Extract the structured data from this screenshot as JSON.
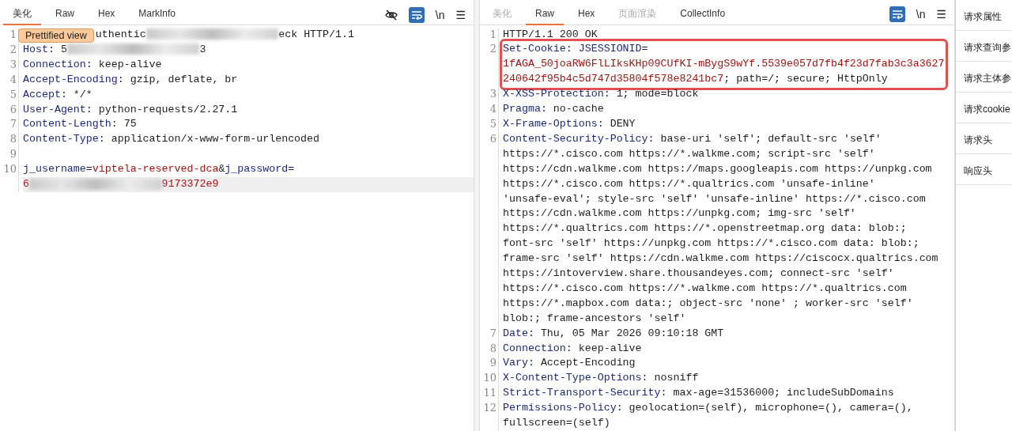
{
  "request": {
    "tabs": [
      {
        "label": "美化",
        "selected": true,
        "disabled": false
      },
      {
        "label": "Raw",
        "selected": false,
        "disabled": false
      },
      {
        "label": "Hex",
        "selected": false,
        "disabled": false
      },
      {
        "label": "MarkInfo",
        "selected": false,
        "disabled": false
      }
    ],
    "toolbar": [
      {
        "kind": "hide",
        "active": false
      },
      {
        "kind": "wrap",
        "active": true
      },
      {
        "kind": "newline",
        "text": "\\n",
        "active": false
      },
      {
        "kind": "menu",
        "text": "☰",
        "active": false
      }
    ],
    "lines": [
      {
        "number": "1",
        "current": false,
        "tooltip": "Prettified view",
        "rows": [
          [
            {
              "kind": "plain",
              "text": "uthentic"
            },
            {
              "kind": "redacted"
            },
            {
              "kind": "plain",
              "text": "eck HTTP/1.1"
            }
          ]
        ]
      },
      {
        "number": "2",
        "current": false,
        "rows": [
          [
            {
              "kind": "key",
              "text": "Host:"
            },
            {
              "kind": "plain",
              "text": " 5"
            },
            {
              "kind": "redacted"
            },
            {
              "kind": "plain",
              "text": "3"
            }
          ]
        ]
      },
      {
        "number": "3",
        "current": false,
        "rows": [
          [
            {
              "kind": "key",
              "text": "Connection:"
            },
            {
              "kind": "plain",
              "text": " keep-alive"
            }
          ]
        ]
      },
      {
        "number": "4",
        "current": false,
        "rows": [
          [
            {
              "kind": "key",
              "text": "Accept-Encoding:"
            },
            {
              "kind": "plain",
              "text": " gzip, deflate, br"
            }
          ]
        ]
      },
      {
        "number": "5",
        "current": false,
        "rows": [
          [
            {
              "kind": "key",
              "text": "Accept:"
            },
            {
              "kind": "plain",
              "text": " */*"
            }
          ]
        ]
      },
      {
        "number": "6",
        "current": false,
        "rows": [
          [
            {
              "kind": "key",
              "text": "User-Agent:"
            },
            {
              "kind": "plain",
              "text": " python-requests/2.27.1"
            }
          ]
        ]
      },
      {
        "number": "7",
        "current": false,
        "rows": [
          [
            {
              "kind": "key",
              "text": "Content-Length:"
            },
            {
              "kind": "plain",
              "text": " 75"
            }
          ]
        ]
      },
      {
        "number": "8",
        "current": false,
        "rows": [
          [
            {
              "kind": "key",
              "text": "Content-Type:"
            },
            {
              "kind": "plain",
              "text": " application/x-www-form-urlencoded"
            }
          ]
        ]
      },
      {
        "number": "9",
        "current": false,
        "rows": [
          []
        ]
      },
      {
        "number": "10",
        "current": true,
        "rows": [
          [
            {
              "kind": "key",
              "text": "j_username"
            },
            {
              "kind": "plain",
              "text": "="
            },
            {
              "kind": "str",
              "text": "viptela-reserved-dca"
            },
            {
              "kind": "plain",
              "text": "&"
            },
            {
              "kind": "key",
              "text": "j_password"
            },
            {
              "kind": "plain",
              "text": "="
            }
          ],
          [
            {
              "kind": "str",
              "text": "6"
            },
            {
              "kind": "redacted"
            },
            {
              "kind": "str",
              "text": "9173372e9"
            }
          ]
        ]
      }
    ]
  },
  "response": {
    "tabs": [
      {
        "label": "美化",
        "selected": false,
        "disabled": true
      },
      {
        "label": "Raw",
        "selected": true,
        "disabled": false
      },
      {
        "label": "Hex",
        "selected": false,
        "disabled": false
      },
      {
        "label": "页面渲染",
        "selected": false,
        "disabled": true
      },
      {
        "label": "CollectInfo",
        "selected": false,
        "disabled": false
      }
    ],
    "toolbar": [
      {
        "kind": "wrap",
        "active": true
      },
      {
        "kind": "newline",
        "text": "\\n",
        "active": false
      },
      {
        "kind": "menu",
        "text": "☰",
        "active": false
      }
    ],
    "lines": [
      {
        "number": "1",
        "highlighted": false,
        "rows": [
          [
            {
              "kind": "plain",
              "text": "HTTP/1.1 200 OK"
            }
          ]
        ]
      },
      {
        "number": "2",
        "highlighted": true,
        "rows": [
          [
            {
              "kind": "key",
              "text": "Set-Cookie:"
            },
            {
              "kind": "plain",
              "text": " "
            },
            {
              "kind": "key",
              "text": "JSESSIONID"
            },
            {
              "kind": "plain",
              "text": "="
            }
          ],
          [
            {
              "kind": "str",
              "text": "1fAGA_50joaRW6FlLIksKHp09CUfKI-mBygS9wYf.5539e057d7fb4f23d7fab3c3a3627"
            }
          ],
          [
            {
              "kind": "str",
              "text": "240642f95b4c5d747d35804f578e8241bc7"
            },
            {
              "kind": "plain",
              "text": "; path=/; secure; HttpOnly"
            }
          ]
        ]
      },
      {
        "number": "3",
        "highlighted": false,
        "rows": [
          [
            {
              "kind": "key",
              "text": "X-XSS-Protection:"
            },
            {
              "kind": "plain",
              "text": " 1; mode=block"
            }
          ]
        ]
      },
      {
        "number": "4",
        "highlighted": false,
        "rows": [
          [
            {
              "kind": "key",
              "text": "Pragma:"
            },
            {
              "kind": "plain",
              "text": " no-cache"
            }
          ]
        ]
      },
      {
        "number": "5",
        "highlighted": false,
        "rows": [
          [
            {
              "kind": "key",
              "text": "X-Frame-Options:"
            },
            {
              "kind": "plain",
              "text": " DENY"
            }
          ]
        ]
      },
      {
        "number": "6",
        "highlighted": false,
        "rows": [
          [
            {
              "kind": "key",
              "text": "Content-Security-Policy:"
            },
            {
              "kind": "plain",
              "text": " base-uri 'self'; default-src 'self'"
            }
          ],
          [
            {
              "kind": "plain",
              "text": "https://*.cisco.com https://*.walkme.com; script-src 'self'"
            }
          ],
          [
            {
              "kind": "plain",
              "text": "https://cdn.walkme.com https://maps.googleapis.com https://unpkg.com"
            }
          ],
          [
            {
              "kind": "plain",
              "text": "https://*.cisco.com https://*.qualtrics.com 'unsafe-inline'"
            }
          ],
          [
            {
              "kind": "plain",
              "text": "'unsafe-eval'; style-src 'self' 'unsafe-inline' https://*.cisco.com"
            }
          ],
          [
            {
              "kind": "plain",
              "text": "https://cdn.walkme.com https://unpkg.com; img-src 'self'"
            }
          ],
          [
            {
              "kind": "plain",
              "text": "https://*.qualtrics.com https://*.openstreetmap.org data: blob:;"
            }
          ],
          [
            {
              "kind": "plain",
              "text": "font-src 'self' https://unpkg.com https://*.cisco.com data: blob:;"
            }
          ],
          [
            {
              "kind": "plain",
              "text": "frame-src 'self' https://cdn.walkme.com https://ciscocx.qualtrics.com"
            }
          ],
          [
            {
              "kind": "plain",
              "text": "https://intoverview.share.thousandeyes.com; connect-src 'self'"
            }
          ],
          [
            {
              "kind": "plain",
              "text": "https://*.cisco.com https://*.walkme.com https://*.qualtrics.com"
            }
          ],
          [
            {
              "kind": "plain",
              "text": "https://*.mapbox.com data:; object-src 'none' ; worker-src 'self'"
            }
          ],
          [
            {
              "kind": "plain",
              "text": "blob:; frame-ancestors 'self'"
            }
          ]
        ]
      },
      {
        "number": "7",
        "highlighted": false,
        "rows": [
          [
            {
              "kind": "key",
              "text": "Date:"
            },
            {
              "kind": "plain",
              "text": " Thu, 05 Mar 2026 09:10:18 GMT"
            }
          ]
        ]
      },
      {
        "number": "8",
        "highlighted": false,
        "rows": [
          [
            {
              "kind": "key",
              "text": "Connection:"
            },
            {
              "kind": "plain",
              "text": " keep-alive"
            }
          ]
        ]
      },
      {
        "number": "9",
        "highlighted": false,
        "rows": [
          [
            {
              "kind": "key",
              "text": "Vary:"
            },
            {
              "kind": "plain",
              "text": " Accept-Encoding"
            }
          ]
        ]
      },
      {
        "number": "10",
        "highlighted": false,
        "rows": [
          [
            {
              "kind": "key",
              "text": "X-Content-Type-Options:"
            },
            {
              "kind": "plain",
              "text": " nosniff"
            }
          ]
        ]
      },
      {
        "number": "11",
        "highlighted": false,
        "rows": [
          [
            {
              "kind": "key",
              "text": "Strict-Transport-Security:"
            },
            {
              "kind": "plain",
              "text": " max-age=31536000; includeSubDomains"
            }
          ]
        ]
      },
      {
        "number": "12",
        "highlighted": false,
        "rows": [
          [
            {
              "kind": "key",
              "text": "Permissions-Policy:"
            },
            {
              "kind": "plain",
              "text": " geolocation=(self), microphone=(), camera=(),"
            }
          ],
          [
            {
              "kind": "plain",
              "text": "fullscreen=(self)"
            }
          ]
        ]
      }
    ]
  },
  "sidebar": {
    "items": [
      {
        "label": "请求属性"
      },
      {
        "label": "请求查询参"
      },
      {
        "label": "请求主体参"
      },
      {
        "label": "请求cookie"
      },
      {
        "label": "请求头"
      },
      {
        "label": "响应头"
      }
    ]
  }
}
